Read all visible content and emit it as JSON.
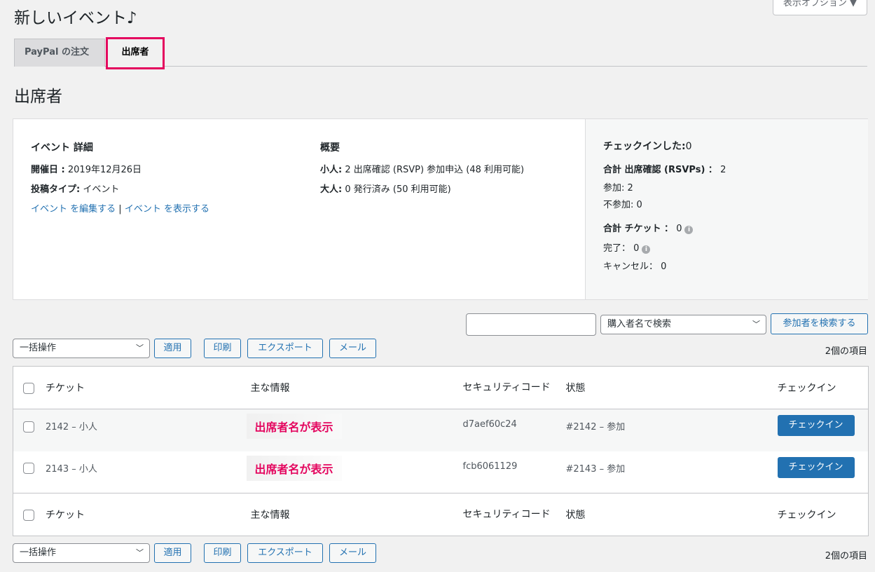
{
  "screen_options": "表示オプション ▼",
  "page_title": "新しいイベント♪",
  "tabs": [
    {
      "label": "PayPal の注文"
    },
    {
      "label": "出席者"
    }
  ],
  "section_title": "出席者",
  "event_details": {
    "heading": "イベント 詳細",
    "date_label": "開催日 :",
    "date_value": "2019年12月26日",
    "post_type_label": "投稿タイプ:",
    "post_type_value": "イベント",
    "edit_link": "イベント を編集する",
    "separator": "|",
    "view_link": "イベント を表示する"
  },
  "overview": {
    "heading": "概要",
    "child_label": "小人:",
    "child_value": "2 出席確認 (RSVP) 参加申込 (48 利用可能)",
    "adult_label": "大人:",
    "adult_value": "0 発行済み (50 利用可能)"
  },
  "checkin_stats": {
    "heading": "チェックインした:",
    "heading_value": "0",
    "total_rsvp_label": "合計 出席確認 (RSVPs) ：",
    "total_rsvp_value": "2",
    "going": "参加: 2",
    "not_going": "不参加: 0",
    "total_tickets_label": "合計 チケット ：",
    "total_tickets_value": "0",
    "completed": "完了：",
    "completed_value": "0",
    "cancelled": "キャンセル：",
    "cancelled_value": "0"
  },
  "search": {
    "input_value": "",
    "field_select": "購入者名で検索",
    "button": "参加者を検索する"
  },
  "bulk": {
    "select": "一括操作",
    "apply": "適用",
    "print": "印刷",
    "export": "エクスポート",
    "email": "メール",
    "count": "2個の項目"
  },
  "columns": {
    "ticket": "チケット",
    "primary_info": "主な情報",
    "security_code": "セキュリティコード",
    "status": "状態",
    "checkin": "チェックイン"
  },
  "rows": [
    {
      "ticket": "2142 – 小人",
      "name_note": "出席者名が表示",
      "security_code": "d7aef60c24",
      "status": "#2142 – 参加",
      "checkin": "チェックイン"
    },
    {
      "ticket": "2143 – 小人",
      "name_note": "出席者名が表示",
      "security_code": "fcb6061129",
      "status": "#2143 – 参加",
      "checkin": "チェックイン"
    }
  ],
  "colors": {
    "accent": "#2271b1",
    "highlight": "#e4055e"
  }
}
